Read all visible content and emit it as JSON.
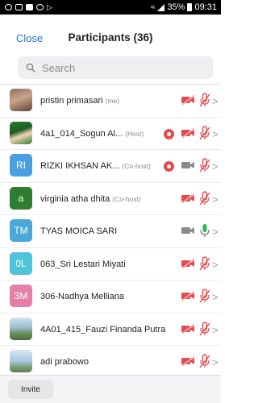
{
  "status_bar": {
    "battery": "35%",
    "time": "09:31",
    "left_icons": [
      "whatsapp-icon",
      "gallery-icon",
      "video-icon",
      "rotate-icon",
      "play-icon"
    ]
  },
  "header": {
    "close_label": "Close",
    "title": "Participants (36)"
  },
  "search": {
    "placeholder": "Search"
  },
  "colors": {
    "accent": "#1a73d9",
    "muted_red": "#e5484d",
    "unmuted_green": "#2fb84c"
  },
  "participants": [
    {
      "name": "pristin primasari",
      "role": "(me)",
      "avatar": "photo",
      "recording": false,
      "video": "off",
      "mic": "muted"
    },
    {
      "name": "4a1_014_Sogun Al...",
      "role": "(Host)",
      "avatar": "photo",
      "recording": true,
      "video": "off",
      "mic": "muted"
    },
    {
      "name": "RIZKI IKHSAN AK...",
      "role": "(Co-host)",
      "avatar": "initials",
      "initials": "RI",
      "avatar_color": "#4a9fe3",
      "recording": true,
      "video": "on",
      "mic": "muted"
    },
    {
      "name": "virginia atha dhita",
      "role": "(Co-host)",
      "avatar": "initials",
      "initials": "a",
      "avatar_color": "#2e7d32",
      "recording": false,
      "video": "off",
      "mic": "muted"
    },
    {
      "name": "TYAS MOICA SARI",
      "role": "",
      "avatar": "initials",
      "initials": "TM",
      "avatar_color": "#4aa8d8",
      "recording": false,
      "video": "on",
      "mic": "unmuted"
    },
    {
      "name": "063_Sri Lestari Miyati",
      "role": "",
      "avatar": "initials",
      "initials": "0L",
      "avatar_color": "#4fc3d9",
      "recording": false,
      "video": "off",
      "mic": "muted"
    },
    {
      "name": "306-Nadhya Melliana",
      "role": "",
      "avatar": "initials",
      "initials": "3M",
      "avatar_color": "#e57fa8",
      "recording": false,
      "video": "off",
      "mic": "muted"
    },
    {
      "name": "4A01_415_Fauzi Finanda Putra",
      "role": "",
      "avatar": "photo",
      "recording": false,
      "video": "off",
      "mic": "muted"
    },
    {
      "name": "adi prabowo",
      "role": "",
      "avatar": "photo",
      "recording": false,
      "video": "off",
      "mic": "muted"
    }
  ],
  "footer": {
    "invite_label": "Invite"
  }
}
